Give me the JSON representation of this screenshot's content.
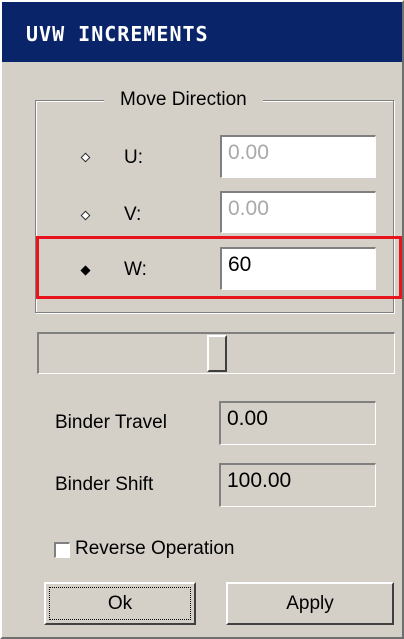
{
  "window": {
    "title": "UVW INCREMENTS"
  },
  "move_direction": {
    "legend": "Move Direction",
    "options": [
      {
        "label": "U:",
        "value": "0.00",
        "selected": false,
        "disabled": true
      },
      {
        "label": "V:",
        "value": "0.00",
        "selected": false,
        "disabled": true
      },
      {
        "label": "W:",
        "value": "60",
        "selected": true,
        "disabled": false
      }
    ]
  },
  "slider": {
    "level_fraction": 0.5
  },
  "binder": {
    "travel_label": "Binder Travel",
    "travel_value": "0.00",
    "shift_label": "Binder Shift",
    "shift_value": "100.00"
  },
  "reverse_operation": {
    "label": "Reverse Operation",
    "checked": false
  },
  "buttons": {
    "ok": "Ok",
    "apply": "Apply"
  },
  "colors": {
    "highlight": "#e8131d",
    "title_bar": "#0a246a",
    "dialog_bg": "#d4d0c8"
  }
}
